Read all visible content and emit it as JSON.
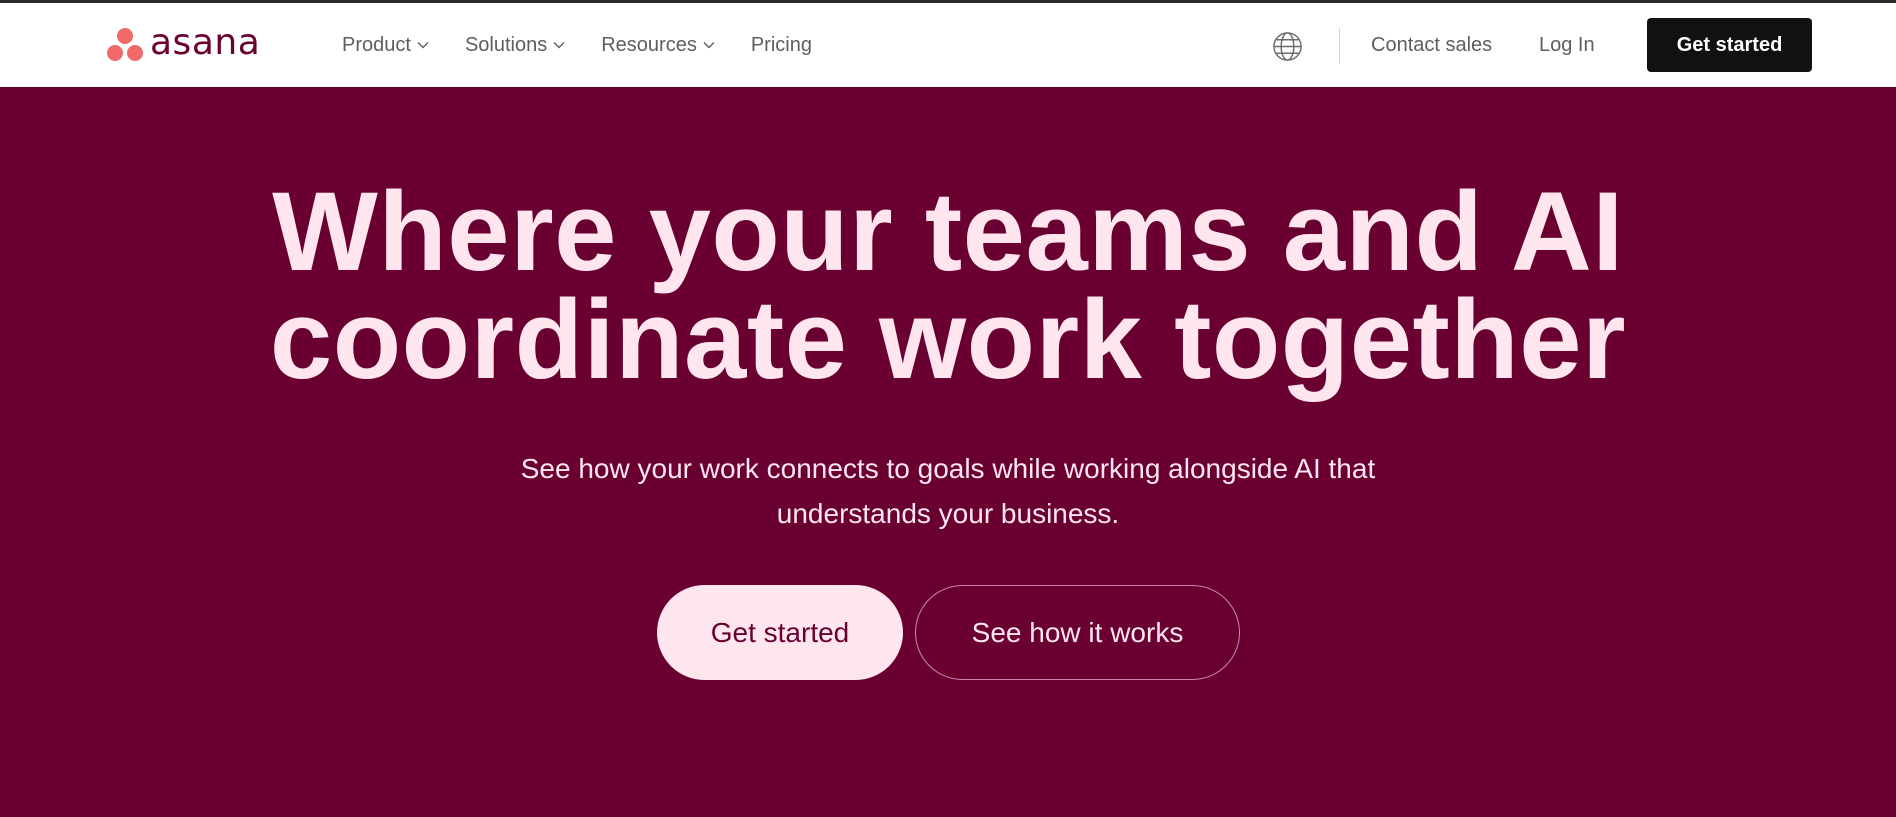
{
  "brand": {
    "name": "asana",
    "logo_dot_color": "#f06a6a",
    "text_color": "#690031"
  },
  "nav": {
    "items": [
      {
        "label": "Product",
        "has_dropdown": true
      },
      {
        "label": "Solutions",
        "has_dropdown": true
      },
      {
        "label": "Resources",
        "has_dropdown": true
      },
      {
        "label": "Pricing",
        "has_dropdown": false
      }
    ],
    "globe_icon": "globe-icon",
    "contact_sales": "Contact sales",
    "login": "Log In",
    "cta": "Get started"
  },
  "hero": {
    "title_line1": "Where your teams and AI",
    "title_line2": "coordinate work together",
    "subtitle_line1": "See how your work connects to goals while working alongside AI that",
    "subtitle_line2": "understands your business.",
    "primary_button": "Get started",
    "secondary_button": "See how it works"
  },
  "colors": {
    "hero_background": "#690031",
    "hero_text": "#ffe5ee",
    "nav_cta_background": "#111111"
  }
}
